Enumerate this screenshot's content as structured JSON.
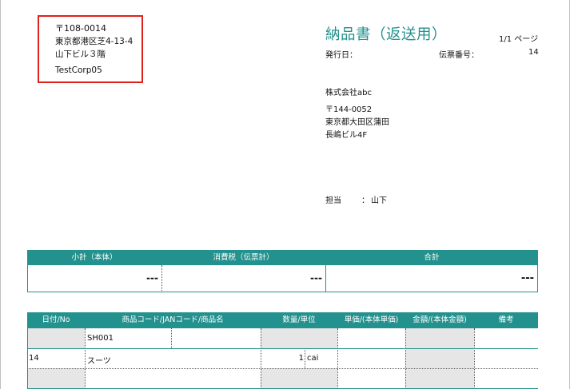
{
  "sender": {
    "postal_code": "〒108-0014",
    "address_line1": "東京都港区芝4-13-4",
    "address_line2": "山下ビル３階",
    "company": "TestCorp05"
  },
  "document": {
    "title": "納品書（返送用）",
    "page_count": "1/1 ページ",
    "issue_date_label": "発行日：",
    "issue_date_value": "",
    "slip_number_label": "伝票番号：",
    "slip_number_value": "14"
  },
  "recipient": {
    "company": "株式会社abc",
    "postal_code": "〒144-0052",
    "address_line1": "東京都大田区蒲田",
    "address_line2": "長嶋ビル4F",
    "staff_label": "担当",
    "staff_separator": "：",
    "staff_name": "山下"
  },
  "summary": {
    "headers": [
      "小計（本体）",
      "消費税（伝票計）",
      "合計"
    ],
    "values": [
      "---",
      "---",
      "---"
    ]
  },
  "detail": {
    "headers": [
      "日付/No",
      "商品コード/JANコード/商品名",
      "数量/単位",
      "単価/(本体単価)",
      "金額/(本体金額)",
      "備考"
    ],
    "rows": [
      {
        "date_no": "",
        "code": "SH001",
        "jan": "",
        "qty": "",
        "unit": ""
      },
      {
        "date_no": "14",
        "code": "スーツ",
        "jan": "",
        "qty": "1",
        "unit": "cai"
      }
    ]
  },
  "colors": {
    "accent": "#23918d",
    "highlight_border": "#e0201b",
    "shaded_cell": "#e6e6e6"
  }
}
